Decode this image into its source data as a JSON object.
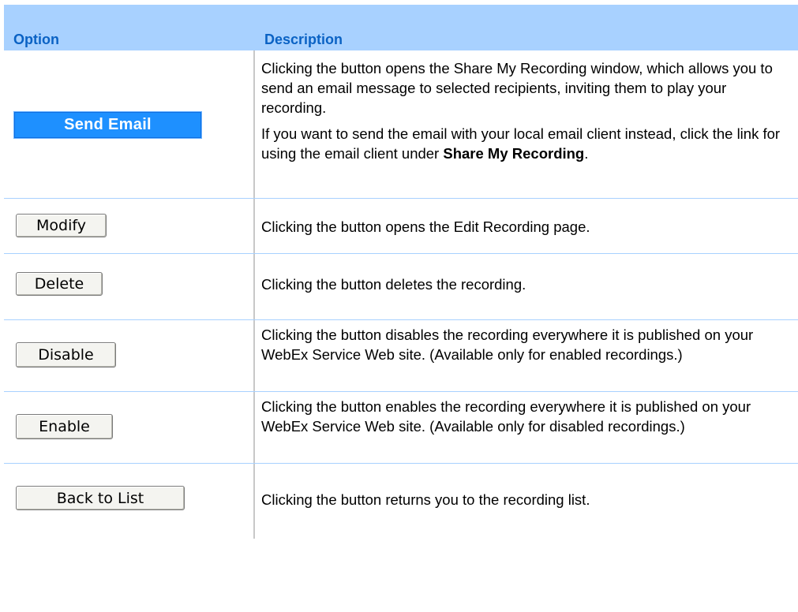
{
  "header": {
    "option": "Option",
    "description": "Description"
  },
  "rows": {
    "send_email": {
      "button": "Send Email",
      "desc_p1": "Clicking the button opens the Share My Recording window, which allows you to send an email message to selected recipients, inviting them to play your recording.",
      "desc_p2_pre": "If you want to send the email with your local email client instead, click the link for using the email client under ",
      "desc_p2_bold": "Share My Recording",
      "desc_p2_post": "."
    },
    "modify": {
      "button": "Modify",
      "desc": "Clicking the button opens the Edit Recording page."
    },
    "delete": {
      "button": "Delete",
      "desc": "Clicking the button deletes the recording."
    },
    "disable": {
      "button": "Disable",
      "desc": "Clicking the button disables the recording everywhere it is published on your WebEx Service Web site. (Available only for enabled recordings.)"
    },
    "enable": {
      "button": "Enable",
      "desc": "Clicking the button enables the recording everywhere it is published on your WebEx Service Web site. (Available only for disabled recordings.)"
    },
    "back_to_list": {
      "button": "Back to List",
      "desc": "Clicking the button returns you to the recording list."
    }
  },
  "colors": {
    "header_bg": "#a8d1ff",
    "header_text": "#0a62c4",
    "send_button_bg": "#1e90ff"
  }
}
